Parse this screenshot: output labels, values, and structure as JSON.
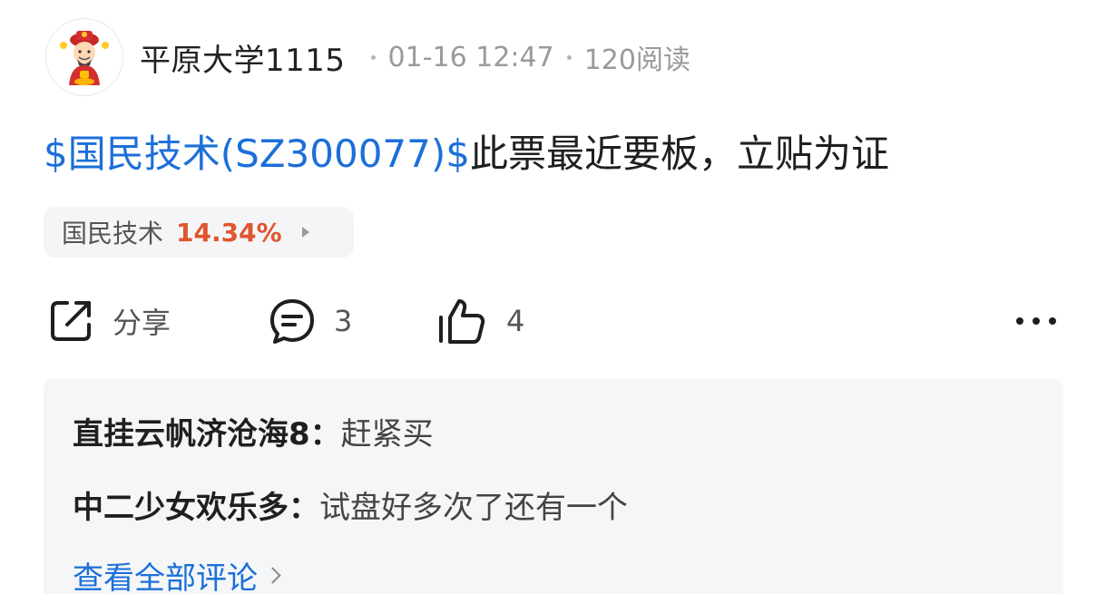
{
  "author": {
    "name": "平原大学1115",
    "avatar_icon": "fortune-god-avatar"
  },
  "meta": {
    "time": "01-16 12:47",
    "reads": "120阅读"
  },
  "post": {
    "stock_link": "$国民技术(SZ300077)$",
    "text": "此票最近要板，立贴为证"
  },
  "stock_chip": {
    "name": "国民技术",
    "change": "14.34%",
    "change_color": "#e0562e"
  },
  "actions": {
    "share_label": "分享",
    "comment_count": "3",
    "like_count": "4",
    "more_icon": "more-icon"
  },
  "comments": {
    "items": [
      {
        "author": "直挂云帆济沧海8：",
        "text": "赶紧买"
      },
      {
        "author": "中二少女欢乐多：",
        "text": "试盘好多次了还有一个"
      }
    ],
    "view_all": "查看全部评论"
  },
  "colors": {
    "link": "#1c6fd8",
    "comment_bg": "#f5f6f8"
  }
}
